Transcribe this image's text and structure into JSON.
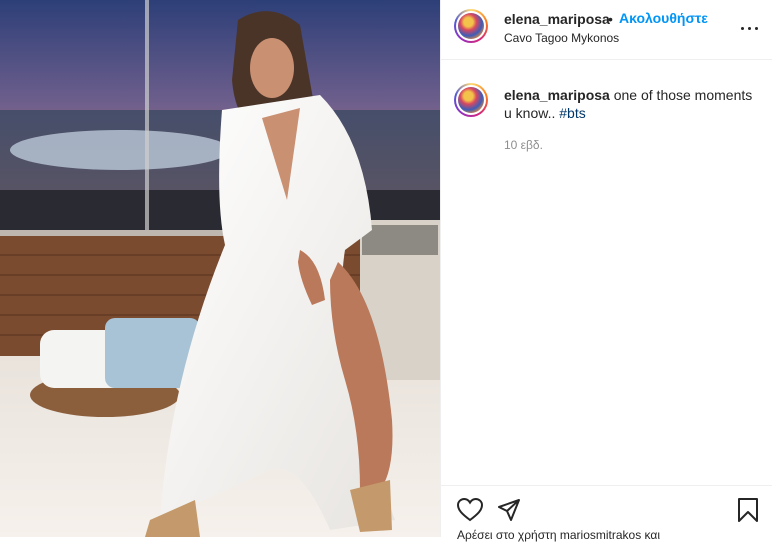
{
  "post": {
    "username": "elena_mariposa",
    "separator": "•",
    "follow_label": "Ακολουθήστε",
    "location": "Cavo Tagoo Mykonos",
    "caption_text": "one of those moments u know..",
    "hashtag": "#bts",
    "time_ago": "10 εβδ.",
    "likes_peek": "Αρέσει στο χρήστη mariosmitrakos και"
  },
  "icons": {
    "more": "more-options-icon",
    "like": "heart-icon",
    "share": "paper-plane-icon",
    "save": "bookmark-icon"
  }
}
